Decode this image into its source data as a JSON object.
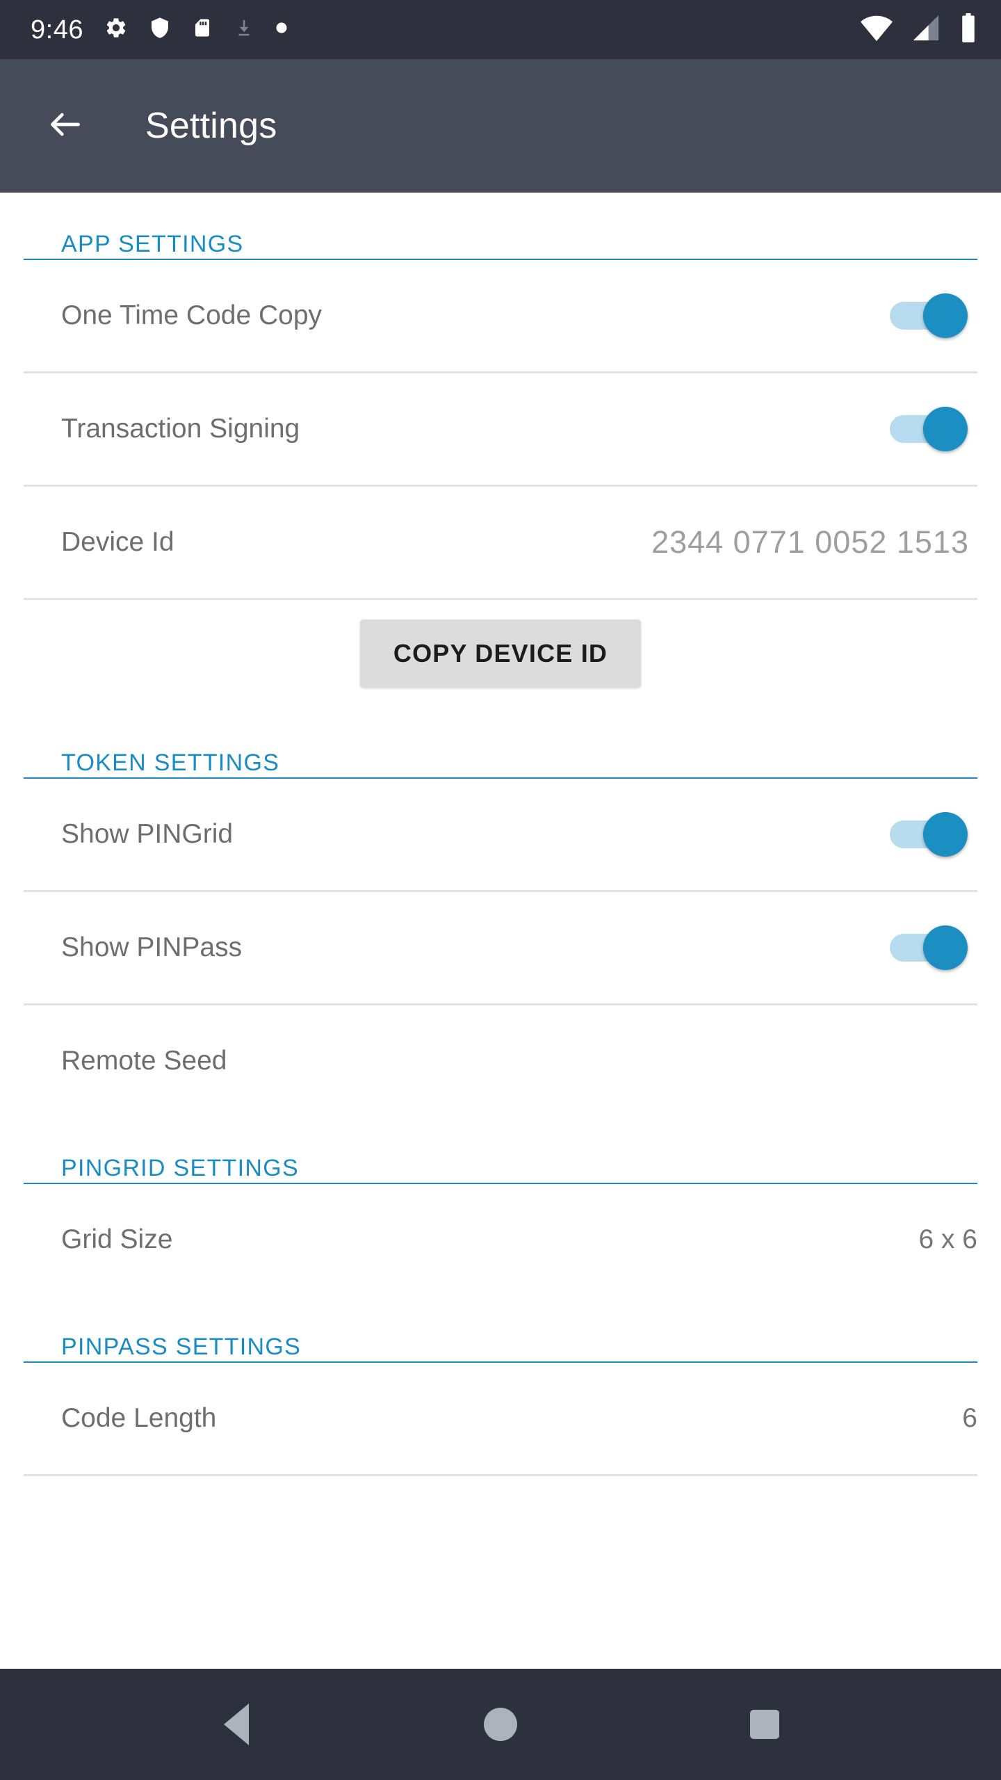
{
  "status_bar": {
    "time": "9:46",
    "left_icons": [
      "gear-icon",
      "shield-icon",
      "sd-card-icon",
      "download-icon",
      "dot-icon"
    ],
    "right_icons": [
      "wifi-icon",
      "cellular-signal-icon",
      "battery-icon"
    ],
    "background": "#2e313d"
  },
  "app_bar": {
    "title": "Settings",
    "back_icon": "arrow-left-icon",
    "background": "#464b59"
  },
  "theme": {
    "accent": "#1a8cc4",
    "toggle_track": "#b7dcef",
    "toggle_thumb": "#1b8ec2",
    "label_color": "#6e6e6e",
    "divider": "#e2e2e2"
  },
  "sections": {
    "app_settings": {
      "header": "APP SETTINGS",
      "rows": {
        "one_time_code_copy": {
          "label": "One Time Code Copy",
          "toggle": "on"
        },
        "transaction_signing": {
          "label": "Transaction Signing",
          "toggle": "on"
        },
        "device_id": {
          "label": "Device Id",
          "value": "2344 0771 0052 1513"
        }
      },
      "copy_button": "COPY DEVICE ID"
    },
    "token_settings": {
      "header": "TOKEN SETTINGS",
      "rows": {
        "show_pingrid": {
          "label": "Show PINGrid",
          "toggle": "on"
        },
        "show_pinpass": {
          "label": "Show PINPass",
          "toggle": "on"
        },
        "remote_seed": {
          "label": "Remote Seed"
        }
      }
    },
    "pingrid_settings": {
      "header": "PINGRID SETTINGS",
      "rows": {
        "grid_size": {
          "label": "Grid Size",
          "value": "6 x 6"
        }
      }
    },
    "pinpass_settings": {
      "header": "PINPASS SETTINGS",
      "rows": {
        "code_length": {
          "label": "Code Length",
          "value": "6"
        }
      }
    }
  },
  "nav_bar": {
    "back": "nav-back-icon",
    "home": "nav-home-icon",
    "recents": "nav-recents-icon"
  }
}
